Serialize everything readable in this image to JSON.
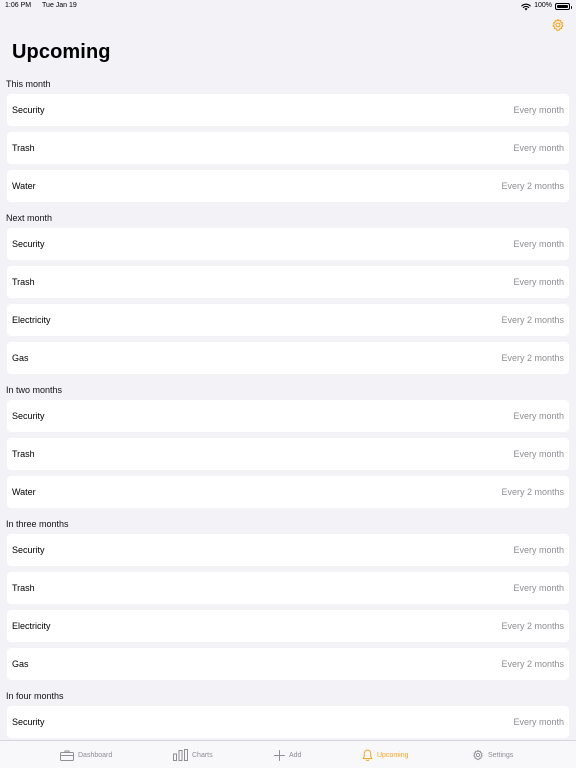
{
  "status_bar": {
    "time": "1:06 PM",
    "date": "Tue Jan 19",
    "battery": "100%"
  },
  "page": {
    "title": "Upcoming"
  },
  "colors": {
    "accent": "#f5a623",
    "secondary_text": "#8e8e93",
    "background": "#f2f2f7"
  },
  "sections": [
    {
      "title": "This month",
      "items": [
        {
          "name": "Security",
          "frequency": "Every month"
        },
        {
          "name": "Trash",
          "frequency": "Every month"
        },
        {
          "name": "Water",
          "frequency": "Every 2 months"
        }
      ]
    },
    {
      "title": "Next month",
      "items": [
        {
          "name": "Security",
          "frequency": "Every month"
        },
        {
          "name": "Trash",
          "frequency": "Every month"
        },
        {
          "name": "Electricity",
          "frequency": "Every 2 months"
        },
        {
          "name": "Gas",
          "frequency": "Every 2 months"
        }
      ]
    },
    {
      "title": "In two months",
      "items": [
        {
          "name": "Security",
          "frequency": "Every month"
        },
        {
          "name": "Trash",
          "frequency": "Every month"
        },
        {
          "name": "Water",
          "frequency": "Every 2 months"
        }
      ]
    },
    {
      "title": "In three months",
      "items": [
        {
          "name": "Security",
          "frequency": "Every month"
        },
        {
          "name": "Trash",
          "frequency": "Every month"
        },
        {
          "name": "Electricity",
          "frequency": "Every 2 months"
        },
        {
          "name": "Gas",
          "frequency": "Every 2 months"
        }
      ]
    },
    {
      "title": "In four months",
      "items": [
        {
          "name": "Security",
          "frequency": "Every month"
        }
      ]
    }
  ],
  "tab_bar": {
    "tabs": [
      {
        "label": "Dashboard",
        "icon": "dashboard-icon"
      },
      {
        "label": "Charts",
        "icon": "charts-icon"
      },
      {
        "label": "Add",
        "icon": "plus-icon"
      },
      {
        "label": "Upcoming",
        "icon": "bell-icon",
        "active": true
      },
      {
        "label": "Settings",
        "icon": "gear-icon"
      }
    ]
  }
}
